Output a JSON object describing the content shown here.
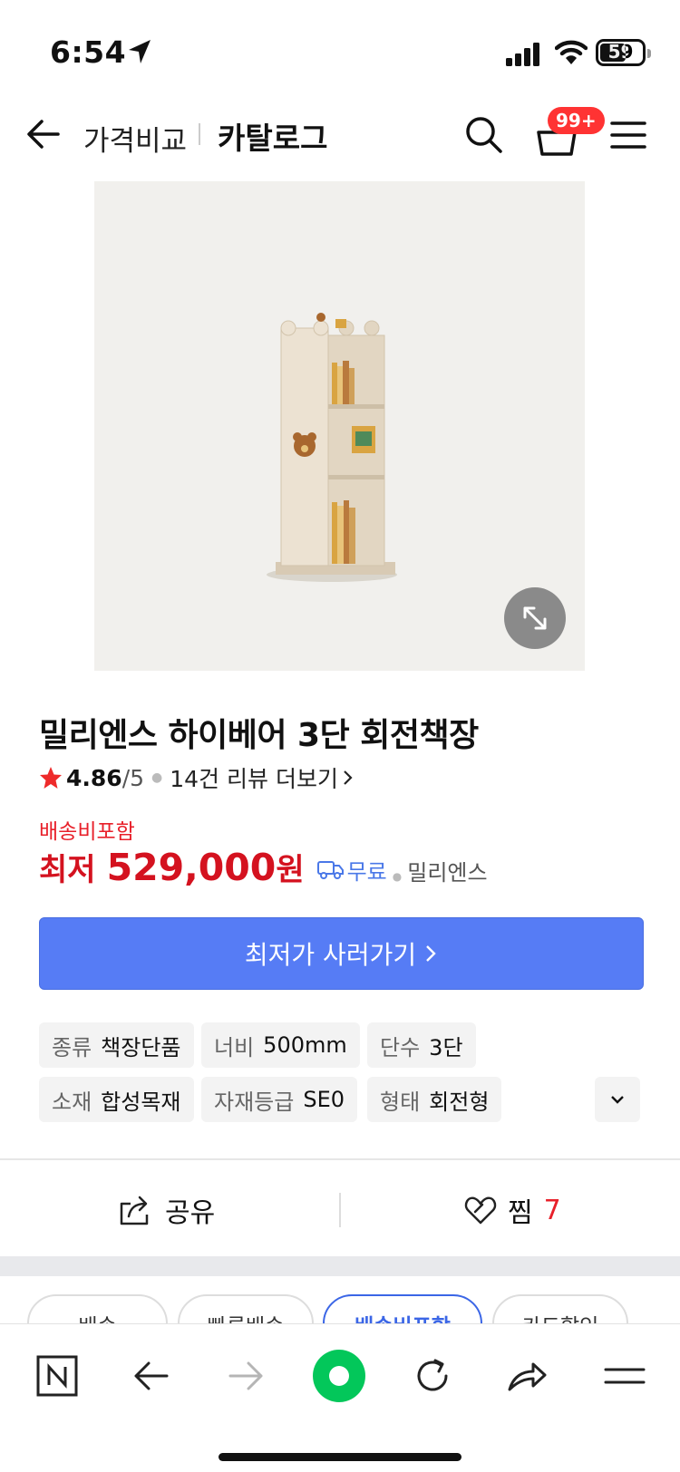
{
  "status_bar": {
    "time": "6:54",
    "battery": "59"
  },
  "header": {
    "crumb_compare": "가격비교",
    "crumb_catalog": "카탈로그",
    "cart_badge": "99+"
  },
  "product": {
    "title": "밀리엔스 하이베어 3단 회전책장",
    "rating": "4.86",
    "rating_max": "/5",
    "review_link": "14건 리뷰 더보기",
    "shipping_included": "배송비포함",
    "price_prefix": "최저",
    "price_value": "529,000",
    "price_unit": "원",
    "free_shipping": "무료",
    "seller": "밀리엔스",
    "buy_label": "최저가 사러가기"
  },
  "specs": [
    {
      "key": "종류",
      "value": "책장단품"
    },
    {
      "key": "너비",
      "value": "500mm"
    },
    {
      "key": "단수",
      "value": "3단"
    },
    {
      "key": "소재",
      "value": "합성목재"
    },
    {
      "key": "자재등급",
      "value": "SE0"
    },
    {
      "key": "형태",
      "value": "회전형"
    }
  ],
  "actions": {
    "share": "공유",
    "zzim": "찜",
    "zzim_count": "7"
  },
  "filters": [
    {
      "label": "배송",
      "active": false
    },
    {
      "label": "빠른배송",
      "active": false
    },
    {
      "label": "배송비포함",
      "active": true
    },
    {
      "label": "카드할인",
      "active": false
    }
  ],
  "colors": {
    "price_red": "#d4121f",
    "accent_blue": "#567cf5",
    "badge_red": "#ff3333",
    "star_red": "#ee2a2a",
    "naver_green": "#03c75a"
  }
}
